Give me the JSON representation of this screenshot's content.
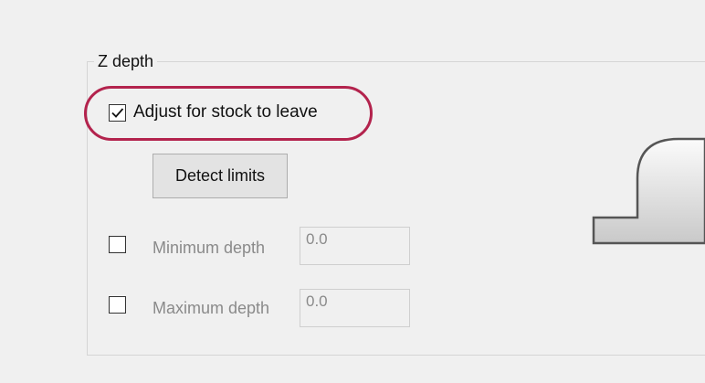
{
  "group": {
    "title": "Z depth"
  },
  "adjust_stock": {
    "label": "Adjust for stock to leave",
    "checked": true
  },
  "detect_button": {
    "label": "Detect limits"
  },
  "minimum_depth": {
    "label": "Minimum depth",
    "value": "0.0",
    "checked": false,
    "enabled": false
  },
  "maximum_depth": {
    "label": "Maximum depth",
    "value": "0.0",
    "checked": false,
    "enabled": false
  },
  "colors": {
    "highlight": "#b3234d",
    "disabled_text": "#8a8a8a",
    "background": "#f0f0f0"
  },
  "icons": {
    "checkmark": "checkmark-icon",
    "profile": "z-depth-profile-icon"
  }
}
